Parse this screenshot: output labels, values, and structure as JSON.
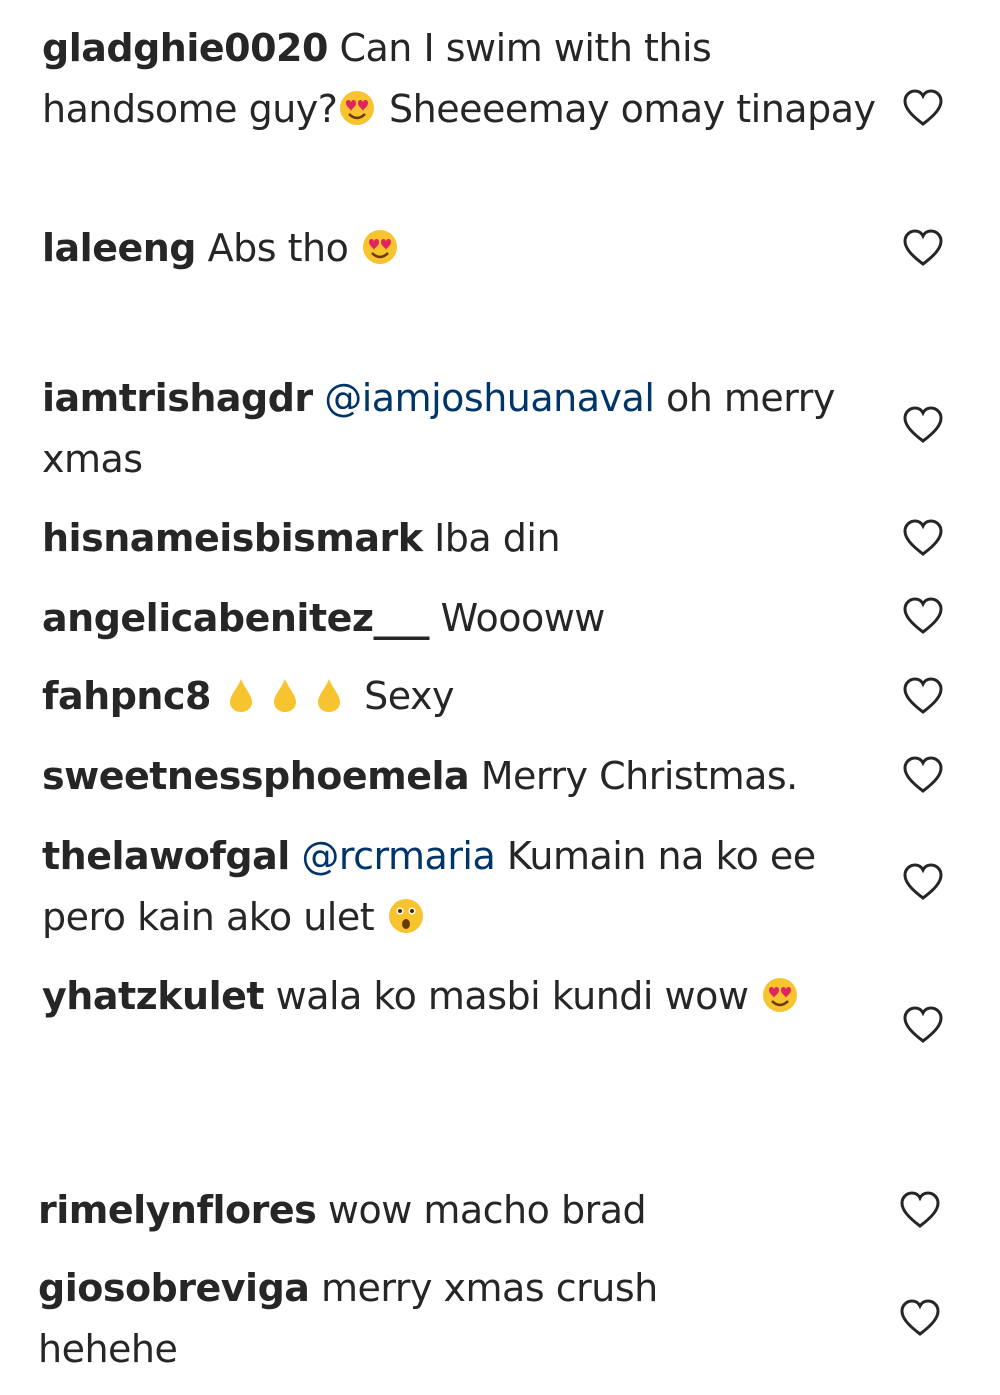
{
  "comments": [
    {
      "username": "gladghie0020",
      "pre": "Can I swim with this handsome guy?",
      "emoji": "heart-eyes",
      "post": " Sheeeemay omay tinapay",
      "liked": false
    },
    {
      "username": "laleeng",
      "pre": "Abs tho ",
      "emoji": "heart-eyes",
      "post": "",
      "liked": false
    },
    {
      "username": "iamtrishagdr",
      "mention": "@iamjoshuanaval",
      "pre": "",
      "post": " oh merry xmas",
      "liked": false
    },
    {
      "username": "hisnameisbismark",
      "pre": "Iba din",
      "liked": false
    },
    {
      "username": "angelicabenitez___",
      "pre": "Woooww",
      "liked": false
    },
    {
      "username": "fahpnc8",
      "emoji": "droplets-x3",
      "post": " Sexy",
      "liked": false
    },
    {
      "username": "sweetnessphoemela",
      "pre": "Merry Christmas.",
      "liked": false
    },
    {
      "username": "thelawofgal",
      "mention": "@rcrmaria",
      "pre": "",
      "post": " Kumain na ko ee pero kain ako ulet ",
      "emoji": "astonished-face",
      "liked": false
    },
    {
      "username": "yhatzkulet",
      "pre": "wala ko masbi kundi wow ",
      "emoji": "heart-eyes",
      "liked": false
    },
    {
      "username": "rimelynflores",
      "pre": "wow macho brad",
      "liked": false
    },
    {
      "username": "giosobreviga",
      "pre": "merry xmas crush hehehe",
      "liked": false
    }
  ],
  "colors": {
    "text": "#262626",
    "mention": "#003569",
    "heart_outline": "#262626",
    "emoji_yellow": "#f7c32e"
  },
  "icons": {
    "like": "heart-outline-icon"
  }
}
